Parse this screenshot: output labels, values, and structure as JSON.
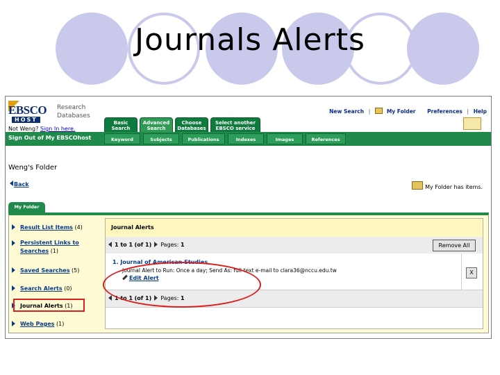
{
  "slide": {
    "title": "Journals Alerts"
  },
  "header": {
    "logo_text": "EBSCO",
    "logo_host": "HOST",
    "product_line1": "Research",
    "product_line2": "Databases",
    "not_who": "Not Weng?",
    "sign_in": "Sign In here.",
    "top_links": [
      "New Search",
      "My Folder",
      "Preferences",
      "Help"
    ]
  },
  "tabs": [
    "Basic Search",
    "Advanced Search",
    "Choose Databases",
    "Select another EBSCO service"
  ],
  "green_bar": {
    "sign_out": "Sign Out of My EBSCOhost",
    "subtabs": [
      "Keyword",
      "Subjects",
      "Publications",
      "Indexes",
      "Images",
      "References"
    ]
  },
  "folder": {
    "title": "Weng's Folder",
    "back": "Back",
    "has_items": "My Folder has items.",
    "tab_label": "My Folder"
  },
  "sidebar": {
    "items": [
      {
        "label": "Result List Items",
        "count": "(4)"
      },
      {
        "label": "Persistent Links to Searches",
        "count": "(1)"
      },
      {
        "label": "Saved Searches",
        "count": "(5)"
      },
      {
        "label": "Search Alerts",
        "count": "(0)"
      },
      {
        "label": "Journal Alerts",
        "count": "(1)"
      },
      {
        "label": "Web Pages",
        "count": "(1)"
      }
    ]
  },
  "main": {
    "heading": "Journal Alerts",
    "pager_range": "1 to 1",
    "pager_of": "(of 1)",
    "pages_label": "Pages:",
    "page_num": "1",
    "remove_all": "Remove All",
    "result_title": "1.  Journal of American Studies",
    "result_desc": "Journal Alert to Run: Once a day; Send As: full-text e-mail to clara36@nccu.edu.tw",
    "edit_alert": "Edit Alert",
    "remove_x": "X"
  },
  "colors": {
    "green": "#1f8a4a",
    "annotation_red": "#d82020",
    "circle_lavender": "#c9c9ec"
  }
}
